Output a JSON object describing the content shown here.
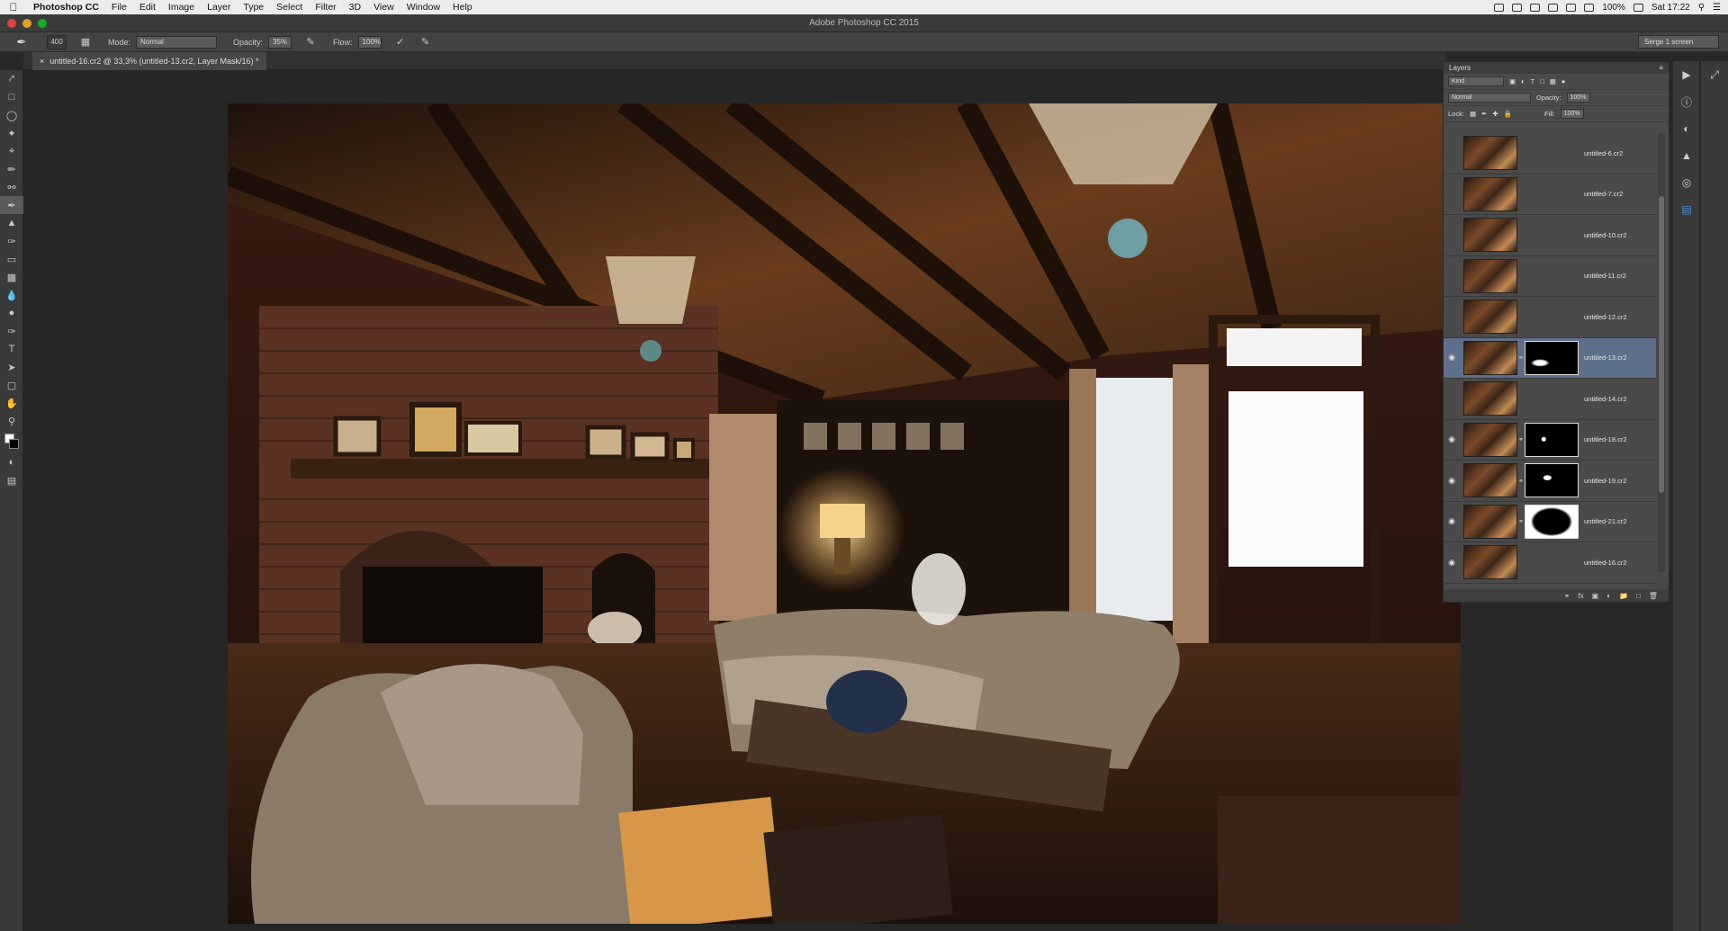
{
  "menubar": {
    "apple": "",
    "items": [
      "Photoshop CC",
      "File",
      "Edit",
      "Image",
      "Layer",
      "Type",
      "Select",
      "Filter",
      "3D",
      "View",
      "Window",
      "Help"
    ],
    "battery": "100%",
    "clock": "Sat 17:22"
  },
  "window": {
    "title": "Adobe Photoshop CC 2015"
  },
  "options": {
    "brush_size": "400",
    "mode_label": "Mode:",
    "mode_value": "Normal",
    "opacity_label": "Opacity:",
    "opacity_value": "35%",
    "flow_label": "Flow:",
    "flow_value": "100%",
    "workspace": "Serge 1 screen"
  },
  "document": {
    "tab": "untitled-16.cr2 @ 33,3% (untitled-13.cr2, Layer Mask/16) *"
  },
  "layers_panel": {
    "title": "Layers",
    "kind": "Kind",
    "blend_mode": "Normal",
    "opacity_label": "Opacity:",
    "opacity_value": "100%",
    "lock_label": "Lock:",
    "fill_label": "Fill:",
    "fill_value": "100%",
    "layers": [
      {
        "name": "untitled-6.cr2",
        "visible": false,
        "mask": "",
        "selected": false
      },
      {
        "name": "untitled-7.cr2",
        "visible": false,
        "mask": "",
        "selected": false
      },
      {
        "name": "untitled-10.cr2",
        "visible": false,
        "mask": "",
        "selected": false
      },
      {
        "name": "untitled-11.cr2",
        "visible": false,
        "mask": "",
        "selected": false
      },
      {
        "name": "untitled-12.cr2",
        "visible": false,
        "mask": "",
        "selected": false
      },
      {
        "name": "untitled-13.cr2",
        "visible": true,
        "mask": "m1",
        "selected": true
      },
      {
        "name": "untitled-14.cr2",
        "visible": false,
        "mask": "",
        "selected": false
      },
      {
        "name": "untitled-18.cr2",
        "visible": true,
        "mask": "m3",
        "selected": false
      },
      {
        "name": "untitled-19.cr2",
        "visible": true,
        "mask": "m4",
        "selected": false
      },
      {
        "name": "untitled-21.cr2",
        "visible": true,
        "mask": "m5",
        "selected": false
      },
      {
        "name": "untitled-16.cr2",
        "visible": true,
        "mask": "",
        "selected": false
      }
    ]
  }
}
